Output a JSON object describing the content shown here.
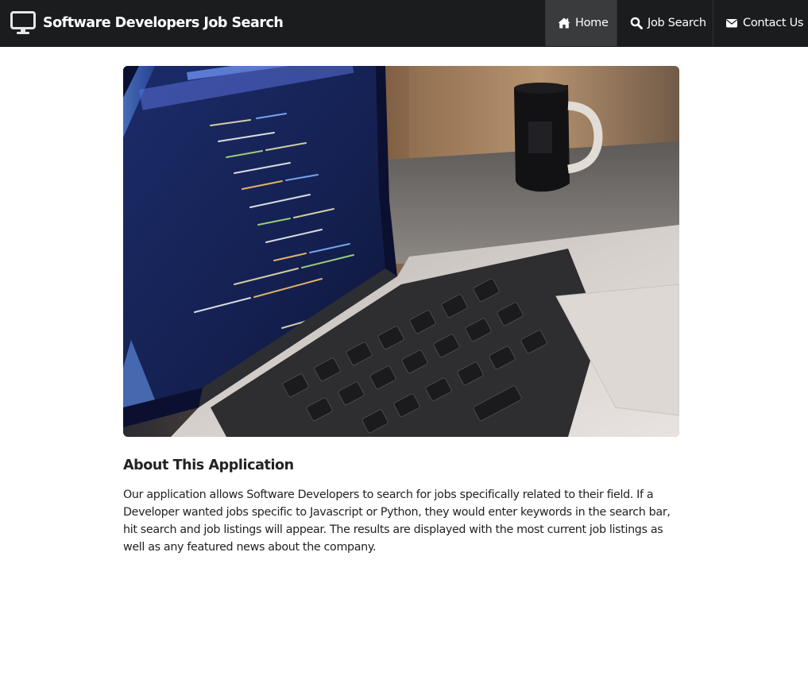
{
  "navbar": {
    "brand_title": "Software Developers Job Search",
    "brand_icon": "desktop-monitor-icon",
    "items": [
      {
        "label": "Home",
        "icon": "home-icon",
        "active": true
      },
      {
        "label": "Job Search",
        "icon": "search-icon",
        "active": false
      },
      {
        "label": "Contact Us",
        "icon": "envelope-icon",
        "active": false
      }
    ]
  },
  "hero": {
    "subject": "laptop with code on screen and coffee mug photo"
  },
  "about": {
    "heading": "About This Application",
    "text": "Our application allows Software Developers to search for jobs specifically related to their field. If a Developer wanted jobs specific to Javascript or Python, they would enter keywords in the search bar, hit search and job listings will appear. The results are displayed with the most current job listings as well as any featured news about the company."
  },
  "colors": {
    "navbar_bg": "#1b1c1d",
    "active_nav_bg": "#3a3b3c",
    "text": "#222222",
    "page_bg": "#ffffff"
  }
}
